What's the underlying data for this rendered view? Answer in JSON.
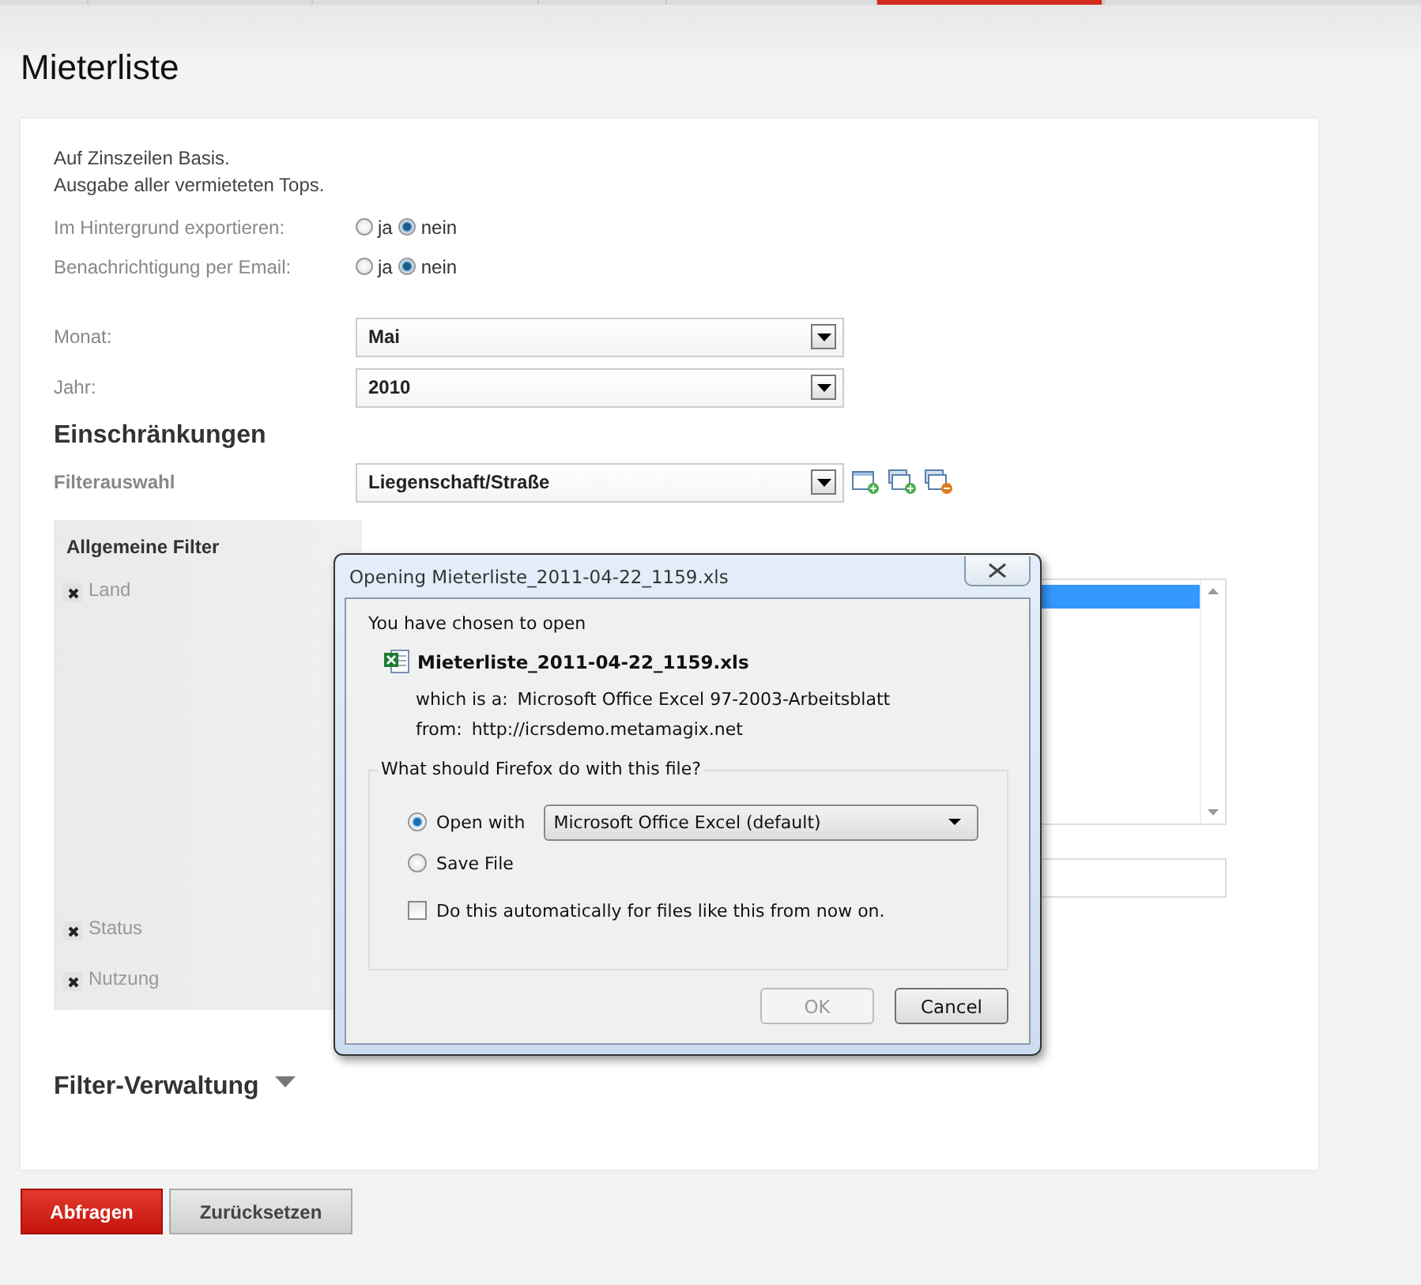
{
  "nav_tabs": [
    {
      "selected": false
    },
    {
      "selected": false
    },
    {
      "selected": false
    },
    {
      "selected": false
    },
    {
      "selected": false
    },
    {
      "selected": true
    },
    {
      "selected": false
    }
  ],
  "page": {
    "title": "Mieterliste"
  },
  "form": {
    "description": [
      "Auf Zinszeilen Basis.",
      "Ausgabe aller vermieteten Tops."
    ],
    "radio_rows": [
      {
        "label": "Im Hintergrund exportieren:",
        "options": [
          {
            "label": "ja",
            "selected": false
          },
          {
            "label": "nein",
            "selected": true
          }
        ]
      },
      {
        "label": "Benachrichtigung per Email:",
        "options": [
          {
            "label": "ja",
            "selected": false
          },
          {
            "label": "nein",
            "selected": true
          }
        ]
      }
    ],
    "selects": [
      {
        "label": "Monat:",
        "value": "Mai"
      },
      {
        "label": "Jahr:",
        "value": "2010"
      }
    ]
  },
  "restrictions": {
    "heading": "Einschränkungen",
    "filter_label": "Filterauswahl",
    "filter_value": "Liegenschaft/Straße"
  },
  "filter_panel": {
    "heading": "Allgemeine Filter",
    "filters": [
      {
        "label": "Land",
        "kind": "list"
      },
      {
        "label": "Status",
        "kind": "plain"
      },
      {
        "label": "Nutzung",
        "kind": "plain"
      }
    ],
    "listbox_rows": [
      {
        "selected": true
      },
      {
        "selected": false
      }
    ]
  },
  "filter_management": {
    "heading": "Filter-Verwaltung"
  },
  "buttons": [
    {
      "label": "Abfragen",
      "kind": "primary"
    },
    {
      "label": "Zurücksetzen",
      "kind": "secondary"
    }
  ],
  "dialog": {
    "title": "Opening Mieterliste_2011-04-22_1159.xls",
    "intro": "You have chosen to open",
    "file_name": "Mieterliste_2011-04-22_1159.xls",
    "details": [
      {
        "label": "which is a:",
        "value": "Microsoft Office Excel 97-2003-Arbeitsblatt"
      },
      {
        "label": "from:",
        "value": "http://icrsdemo.metamagix.net"
      }
    ],
    "group_title": "What should Firefox do with this file?",
    "actions": [
      {
        "label": "Open with",
        "selected": true,
        "app": "Microsoft Office Excel (default)"
      },
      {
        "label": "Save File",
        "selected": false
      }
    ],
    "auto_checkbox": {
      "label": "Do this automatically for files like this from now on.",
      "checked": false
    },
    "buttons": [
      {
        "label": "OK",
        "disabled": true
      },
      {
        "label": "Cancel",
        "disabled": false
      }
    ]
  }
}
